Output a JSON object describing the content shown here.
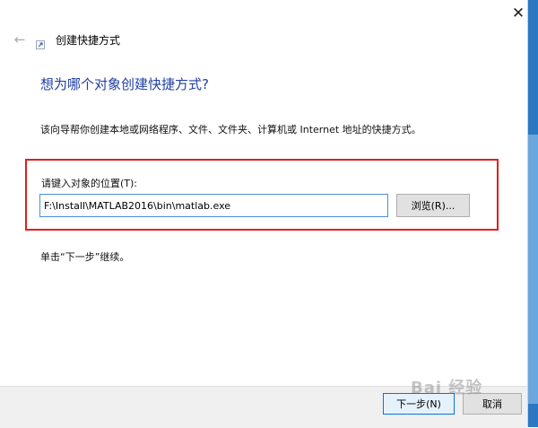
{
  "window": {
    "title": "创建快捷方式",
    "close_glyph": "✕",
    "back_glyph": "←"
  },
  "main": {
    "heading": "想为哪个对象创建快捷方式?",
    "description": "该向导帮你创建本地或网络程序、文件、文件夹、计算机或 Internet 地址的快捷方式。",
    "location_label": "请键入对象的位置(T):",
    "location_value": "F:\\Install\\MATLAB2016\\bin\\matlab.exe",
    "browse_label": "浏览(R)...",
    "continue_hint": "单击“下一步”继续。"
  },
  "footer": {
    "next_label": "下一步(N)",
    "cancel_label": "取消"
  },
  "watermark": {
    "text": "Bai 经验"
  },
  "colors": {
    "heading": "#1f3fa6",
    "highlight_border": "#e02020",
    "input_border": "#4a90d9",
    "desktop_strip": "#2b78c2"
  }
}
